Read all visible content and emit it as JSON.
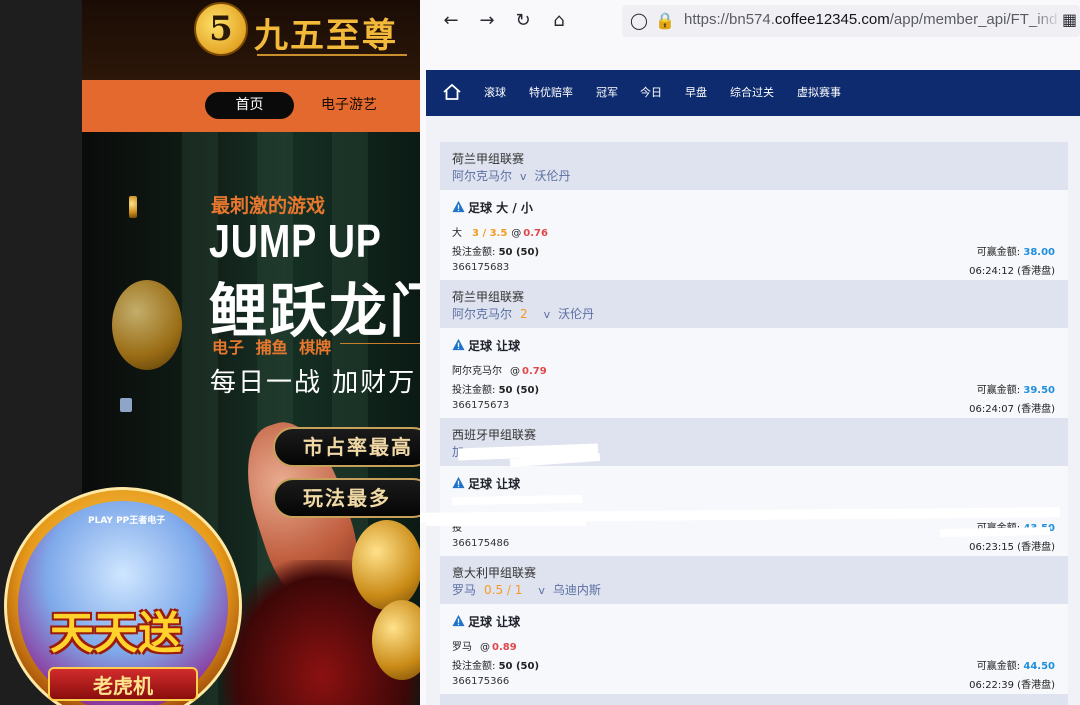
{
  "casino": {
    "logo_digit": "5",
    "logo_text": "九五至尊",
    "nav": {
      "home": "首页",
      "games": "电子游艺"
    },
    "banner": {
      "subtitle": "最刺激的游戏",
      "title_en": "JUMP UP",
      "title_cn": "鲤跃龙门",
      "categories": "电子 捕鱼 棋牌",
      "tagline": "每日一战 加财万",
      "pills": [
        "市占率最高",
        "玩法最多"
      ]
    },
    "promo": {
      "brand": "PLAY PP王者电子",
      "title": "天天送",
      "subtitle": "老虎机"
    }
  },
  "browser": {
    "url_prefix": "https://bn574.",
    "url_domain": "coffee12345.com",
    "url_path": "/app/member_api/FT_ind"
  },
  "site": {
    "nav": [
      "滚球",
      "特优赔率",
      "冠军",
      "今日",
      "早盘",
      "综合过关",
      "虚拟赛事"
    ]
  },
  "bets": [
    {
      "league": "荷兰甲组联赛",
      "home": "阿尔克马尔",
      "handicap": "",
      "vs": "v",
      "away": "沃伦丹",
      "bet_type": "足球 大 / 小",
      "pick": "大",
      "line": "3 / 3.5",
      "at": "@",
      "odds": "0.76",
      "stake_label": "投注金额:",
      "stake": "50 (50)",
      "win_label": "可赢金额:",
      "win": "38.00",
      "ticket": "366175683",
      "time": "06:24:12 (香港盘)"
    },
    {
      "league": "荷兰甲组联赛",
      "home": "阿尔克马尔",
      "handicap": "2",
      "vs": "v",
      "away": "沃伦丹",
      "bet_type": "足球 让球",
      "pick": "阿尔克马尔",
      "line": "",
      "at": "@",
      "odds": "0.79",
      "stake_label": "投注金额:",
      "stake": "50 (50)",
      "win_label": "可赢金额:",
      "win": "39.50",
      "ticket": "366175673",
      "time": "06:24:07 (香港盘)"
    },
    {
      "league": "西班牙甲组联赛",
      "home": "加",
      "handicap": "",
      "vs": "",
      "away": "",
      "bet_type": "足球 让球",
      "pick": "",
      "line": "",
      "at": "",
      "odds": "",
      "stake_label": "投",
      "stake": "",
      "win_label": "可赢金额:",
      "win": "43.50",
      "ticket": "366175486",
      "time": "06:23:15 (香港盘)"
    },
    {
      "league": "意大利甲组联赛",
      "home": "罗马",
      "handicap": "0.5 / 1",
      "vs": "v",
      "away": "乌迪内斯",
      "bet_type": "足球 让球",
      "pick": "罗马",
      "line": "",
      "at": "@",
      "odds": "0.89",
      "stake_label": "投注金额:",
      "stake": "50 (50)",
      "win_label": "可赢金额:",
      "win": "44.50",
      "ticket": "366175366",
      "time": "06:22:39 (香港盘)"
    }
  ]
}
